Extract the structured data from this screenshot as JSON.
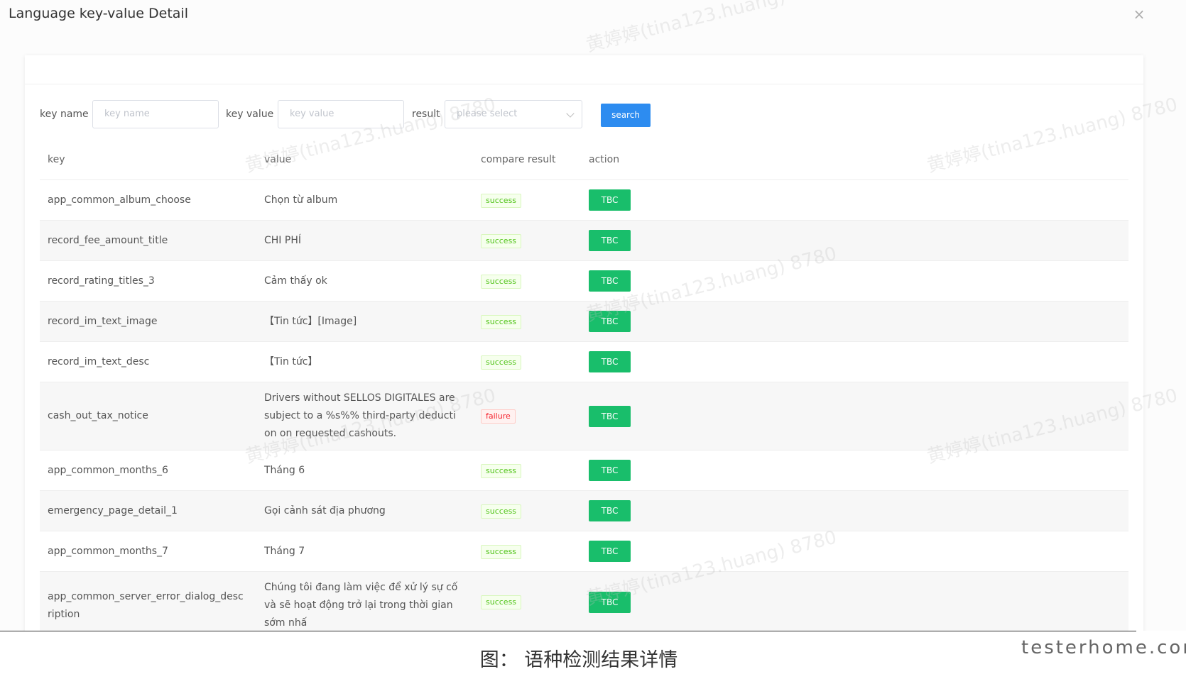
{
  "dialog": {
    "title": "Language key-value Detail",
    "close_label": "×"
  },
  "filters": {
    "key_name_label": "key name",
    "key_name_placeholder": "key name",
    "key_value_label": "key value",
    "key_value_placeholder": "key value",
    "result_label": "result",
    "result_placeholder": "please select",
    "search_label": "search"
  },
  "table": {
    "columns": [
      "key",
      "value",
      "compare result",
      "action"
    ],
    "rows": [
      {
        "key": "app_common_album_choose",
        "value": "Chọn từ album",
        "result": "success",
        "action": "TBC"
      },
      {
        "key": "record_fee_amount_title",
        "value": "CHI PHÍ",
        "result": "success",
        "action": "TBC"
      },
      {
        "key": "record_rating_titles_3",
        "value": "Cảm thấy ok",
        "result": "success",
        "action": "TBC"
      },
      {
        "key": "record_im_text_image",
        "value": "【Tin tức】[Image]",
        "result": "success",
        "action": "TBC"
      },
      {
        "key": "record_im_text_desc",
        "value": "【Tin tức】",
        "result": "success",
        "action": "TBC"
      },
      {
        "key": "cash_out_tax_notice",
        "value": "Drivers without SELLOS DIGITALES are subject to a %s%% third-party deduction on requested cashouts.",
        "result": "failure",
        "action": "TBC"
      },
      {
        "key": "app_common_months_6",
        "value": "Tháng 6",
        "result": "success",
        "action": "TBC"
      },
      {
        "key": "emergency_page_detail_1",
        "value": "Gọi cảnh sát địa phương",
        "result": "success",
        "action": "TBC"
      },
      {
        "key": "app_common_months_7",
        "value": "Tháng 7",
        "result": "success",
        "action": "TBC"
      },
      {
        "key": "app_common_server_error_dialog_description",
        "value": "Chúng tôi đang làm việc để xử lý sự cố và sẽ hoạt động trở lại trong thời gian sớm nhấ",
        "result": "success",
        "action": "TBC"
      }
    ]
  },
  "watermark_text": "黄婷婷(tina123.huang) 8780",
  "caption": "图： 语种检测结果详情",
  "brand": "testerhome.com",
  "colors": {
    "primary": "#2d8cf0",
    "action_green": "#19be6b",
    "success": "#52c41a",
    "failure": "#f5222d"
  }
}
